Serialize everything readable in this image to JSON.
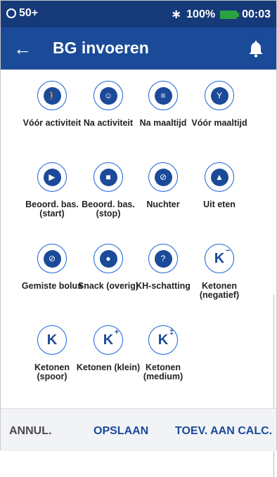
{
  "status_bar": {
    "notifications": "50+",
    "battery": "100%",
    "time": "00:03"
  },
  "header": {
    "title": "BG invoeren"
  },
  "tags": [
    {
      "icon": "walking-person-icon",
      "label": "Vóór activiteit"
    },
    {
      "icon": "smiling-face-icon",
      "label": "Na activiteit"
    },
    {
      "icon": "dish-icon",
      "label": "Na maaltijd"
    },
    {
      "icon": "fork-knife-icon",
      "label": "Vóór maaltijd"
    },
    {
      "icon": "play-icon",
      "label": "Beoord. bas. (start)"
    },
    {
      "icon": "stop-icon",
      "label": "Beoord. bas. (stop)"
    },
    {
      "icon": "no-food-icon",
      "label": "Nuchter"
    },
    {
      "icon": "cloche-icon",
      "label": "Uit eten"
    },
    {
      "icon": "missed-bolus-icon",
      "label": "Gemiste bolus"
    },
    {
      "icon": "apple-icon",
      "label": "Snack (overig)"
    },
    {
      "icon": "toast-icon",
      "label": "KH-schatting"
    },
    {
      "icon": "ketones-negative-icon",
      "label": "Ketonen (negatief)",
      "text": "K",
      "sup": "−"
    },
    {
      "icon": "ketones-trace-icon",
      "label": "Ketonen (spoor)",
      "text": "K",
      "sup": ""
    },
    {
      "icon": "ketones-small-icon",
      "label": "Ketonen (klein)",
      "text": "K",
      "sup": "+"
    },
    {
      "icon": "ketones-medium-icon",
      "label": "Ketonen (medium)",
      "text": "K",
      "sup": "‡"
    }
  ],
  "footer": {
    "cancel": "ANNUL.",
    "save": "OPSLAAN",
    "add_calc": "TOEV. AAN CALC."
  }
}
